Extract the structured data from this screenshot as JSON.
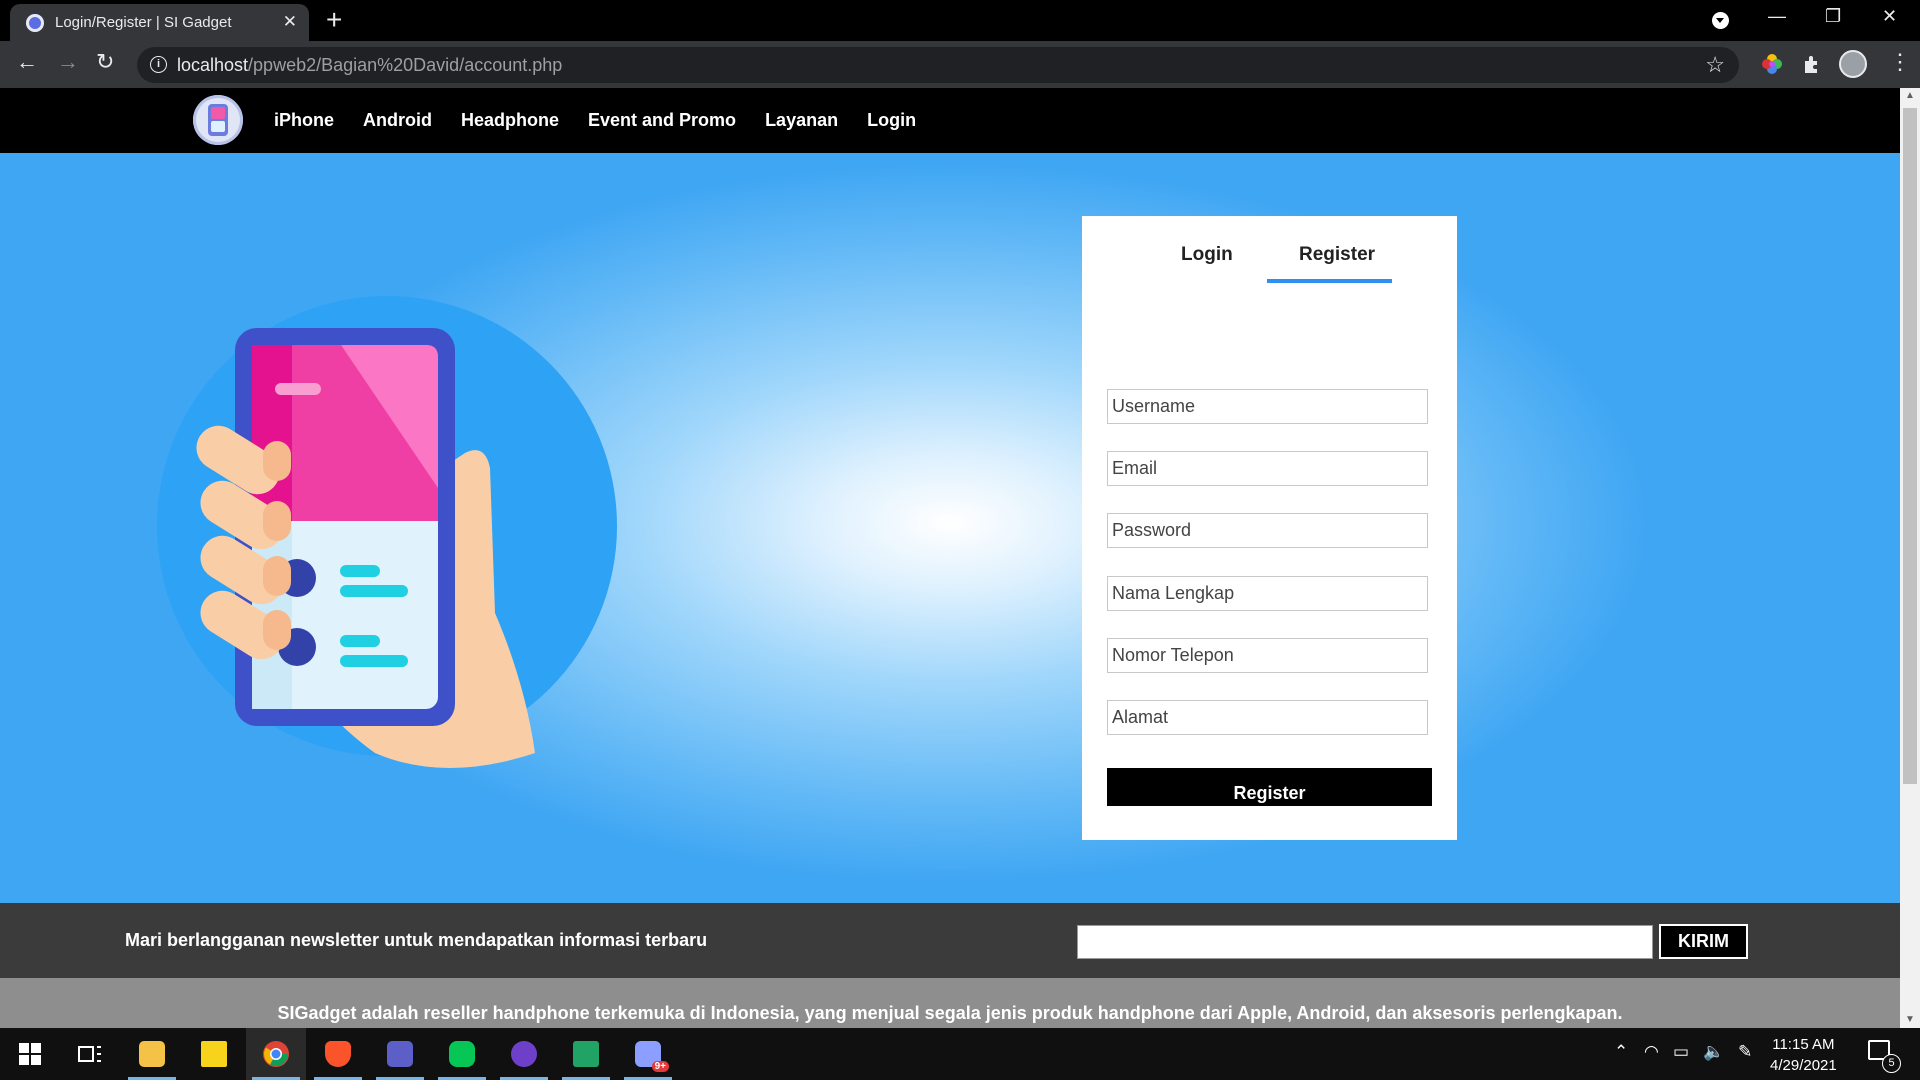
{
  "browser": {
    "tab_title": "Login/Register | SI Gadget",
    "tab_close": "✕",
    "new_tab": "+",
    "url_host": "localhost",
    "url_path": "/ppweb2/Bagian%20David/account.php",
    "window_controls": {
      "minimize": "—",
      "restore": "❐",
      "close": "✕"
    }
  },
  "site": {
    "nav": {
      "items": [
        "iPhone",
        "Android",
        "Headphone",
        "Event and Promo",
        "Layanan",
        "Login"
      ]
    },
    "form": {
      "tabs": {
        "login": "Login",
        "register": "Register"
      },
      "fields": {
        "username": "Username",
        "email": "Email",
        "password": "Password",
        "full_name": "Nama Lengkap",
        "phone": "Nomor Telepon",
        "address": "Alamat"
      },
      "submit": "Register"
    },
    "newsletter": {
      "text": "Mari berlangganan newsletter untuk mendapatkan informasi terbaru",
      "button": "KIRIM",
      "input_value": ""
    },
    "about": "SIGadget adalah reseller handphone terkemuka di Indonesia, yang menjual segala jenis produk handphone dari Apple, Android, dan aksesoris perlengkapan."
  },
  "taskbar": {
    "time": "11:15 AM",
    "date": "4/29/2021",
    "notification_count": "5",
    "badge": "9+"
  },
  "colors": {
    "accent_tab": "#2f8ff2",
    "hero_blue": "#3fa6f3",
    "nav_bg": "#000000",
    "newsletter_bg": "#3b3b3b",
    "about_bg": "#8e8e8e"
  }
}
